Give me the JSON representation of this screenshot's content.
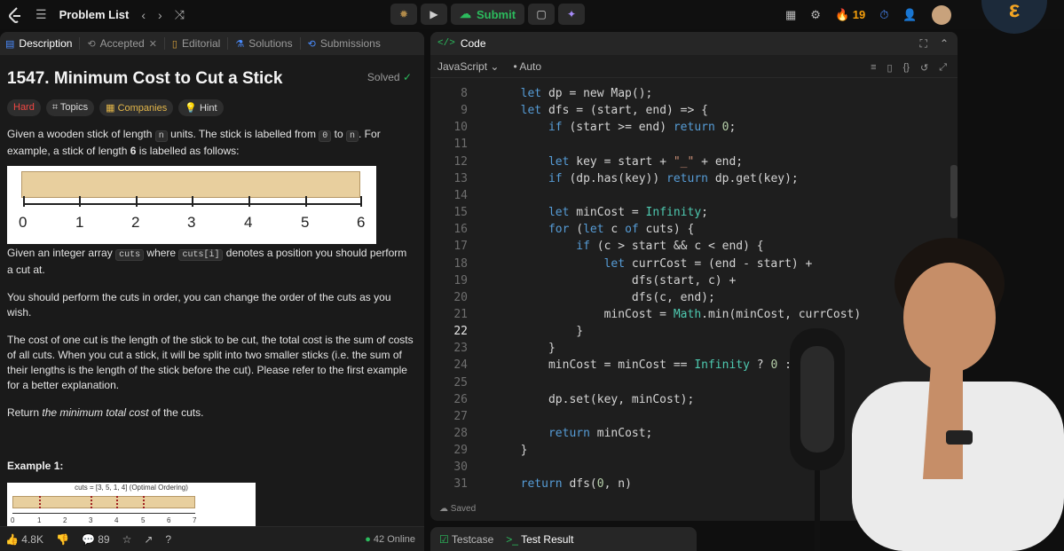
{
  "topbar": {
    "title": "Problem List",
    "submit_label": "Submit",
    "streak": "19"
  },
  "left": {
    "tabs": [
      {
        "label": "Description"
      },
      {
        "label": "Accepted"
      },
      {
        "label": "Editorial"
      },
      {
        "label": "Solutions"
      },
      {
        "label": "Submissions"
      }
    ],
    "title": "1547. Minimum Cost to Cut a Stick",
    "solved_label": "Solved",
    "chips": [
      "Hard",
      "Topics",
      "Companies",
      "Hint"
    ],
    "p1a": "Given a wooden stick of length ",
    "p1_n": "n",
    "p1b": " units. The stick is labelled from ",
    "p1_zero": "0",
    "p1c": " to ",
    "p1_n2": "n",
    "p1d": ". For example, a stick of length ",
    "p1_six": "6",
    "p1e": " is labelled as follows:",
    "ruler_labels": [
      "0",
      "1",
      "2",
      "3",
      "4",
      "5",
      "6"
    ],
    "p2a": "Given an integer array ",
    "p2_cuts": "cuts",
    "p2b": " where ",
    "p2_cutsi": "cuts[i]",
    "p2c": " denotes a position you should perform a cut at.",
    "p3": "You should perform the cuts in order, you can change the order of the cuts as you wish.",
    "p4": "The cost of one cut is the length of the stick to be cut, the total cost is the sum of costs of all cuts. When you cut a stick, it will be split into two smaller sticks (i.e. the sum of their lengths is the length of the stick before the cut). Please refer to the first example for a better explanation.",
    "p5a": "Return ",
    "p5b": "the minimum total cost",
    "p5c": " of the cuts.",
    "example_title": "Example 1:",
    "example_caption": "cuts = [3, 5, 1, 4] (Optimal Ordering)",
    "example_ticks": [
      "0",
      "1",
      "2",
      "3",
      "4",
      "5",
      "6",
      "7"
    ],
    "likes": "4.8K",
    "comments": "89",
    "online": "42 Online"
  },
  "right": {
    "code_title": "Code",
    "language": "JavaScript",
    "auto_label": "Auto",
    "saved_label": "Saved",
    "testcase_label": "Testcase",
    "test_result_label": "Test Result",
    "current_line": "22",
    "lines": [
      {
        "n": "8",
        "t": "  let dp = new Map();"
      },
      {
        "n": "9",
        "t": "  let dfs = (start, end) => {"
      },
      {
        "n": "10",
        "t": "      if (start >= end) return 0;"
      },
      {
        "n": "11",
        "t": ""
      },
      {
        "n": "12",
        "t": "      let key = start + \"_\" + end;"
      },
      {
        "n": "13",
        "t": "      if (dp.has(key)) return dp.get(key);"
      },
      {
        "n": "14",
        "t": ""
      },
      {
        "n": "15",
        "t": "      let minCost = Infinity;"
      },
      {
        "n": "16",
        "t": "      for (let c of cuts) {"
      },
      {
        "n": "17",
        "t": "          if (c > start && c < end) {"
      },
      {
        "n": "18",
        "t": "              let currCost = (end - start) +"
      },
      {
        "n": "19",
        "t": "                  dfs(start, c) +"
      },
      {
        "n": "20",
        "t": "                  dfs(c, end);"
      },
      {
        "n": "21",
        "t": "              minCost = Math.min(minCost, currCost)"
      },
      {
        "n": "22",
        "t": "          }"
      },
      {
        "n": "23",
        "t": "      }"
      },
      {
        "n": "24",
        "t": "      minCost = minCost == Infinity ? 0 : m"
      },
      {
        "n": "25",
        "t": ""
      },
      {
        "n": "26",
        "t": "      dp.set(key, minCost);"
      },
      {
        "n": "27",
        "t": ""
      },
      {
        "n": "28",
        "t": "      return minCost;"
      },
      {
        "n": "29",
        "t": "  }"
      },
      {
        "n": "30",
        "t": ""
      },
      {
        "n": "31",
        "t": "  return dfs(0, n)"
      }
    ]
  }
}
